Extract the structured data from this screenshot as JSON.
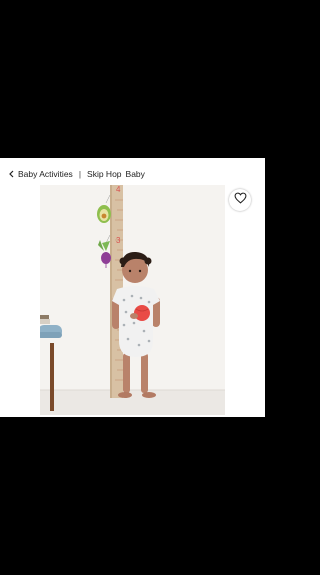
{
  "breadcrumb": {
    "back_label": "Baby Activities",
    "separator": "|",
    "brand_label": "Skip Hop",
    "category_label": "Baby"
  },
  "product_image": {
    "chart_marks": [
      "4",
      "3"
    ]
  },
  "icons": {
    "back": "chevron-left-icon",
    "wishlist": "heart-outline-icon"
  },
  "colors": {
    "background": "#000000",
    "content_bg": "#ffffff",
    "text": "#222222",
    "accent_red": "#d9534f"
  }
}
